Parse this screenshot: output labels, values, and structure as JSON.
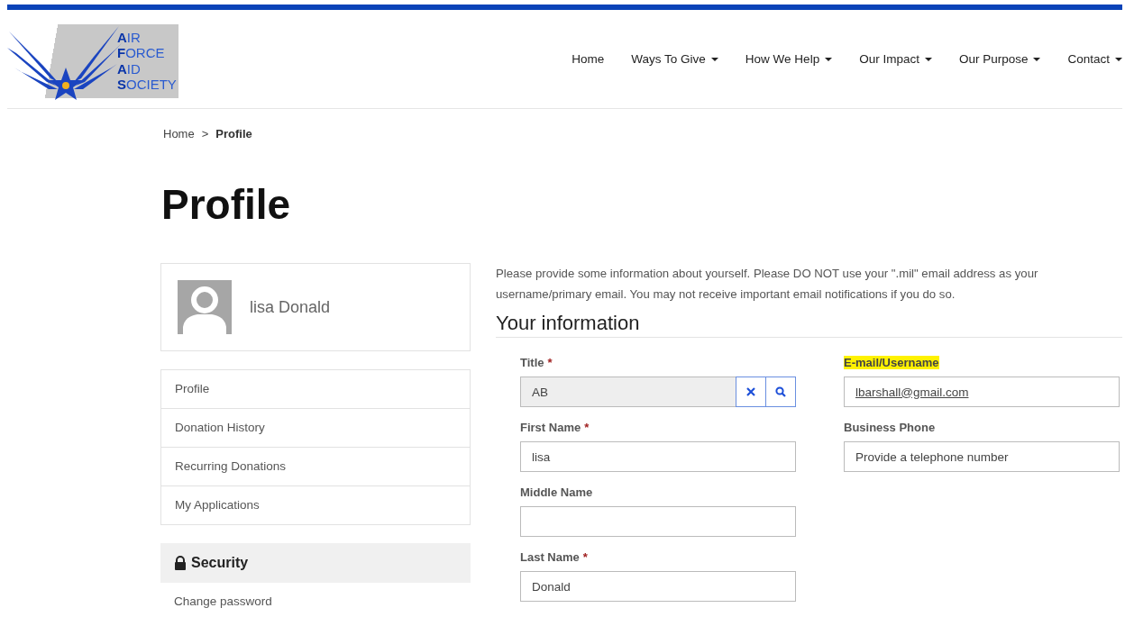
{
  "header": {
    "logo_lines": [
      "**A**IR",
      "**F**ORCE",
      "**A**ID",
      "**S**OCIETY"
    ],
    "nav": [
      {
        "label": "Home",
        "dropdown": false
      },
      {
        "label": "Ways To Give",
        "dropdown": true
      },
      {
        "label": "How We Help",
        "dropdown": true
      },
      {
        "label": "Our Impact",
        "dropdown": true
      },
      {
        "label": "Our Purpose",
        "dropdown": true
      },
      {
        "label": "Contact",
        "dropdown": true
      }
    ]
  },
  "breadcrumb": {
    "items": [
      "Home"
    ],
    "separator": ">",
    "current": "Profile"
  },
  "page_title": "Profile",
  "sidebar": {
    "user_name": "lisa Donald",
    "menu": [
      "Profile",
      "Donation History",
      "Recurring Donations",
      "My Applications"
    ],
    "security": {
      "title": "Security",
      "items": [
        "Change password"
      ]
    }
  },
  "main": {
    "intro": "Please provide some information about yourself. Please DO NOT use your \".mil\" email address as your username/primary email. You may not receive important email notifications if you do so.",
    "section_title": "Your information",
    "columns": [
      [
        {
          "kind": "lookup",
          "label": "Title",
          "mark": "*",
          "value": "AB",
          "highlighted": false
        },
        {
          "kind": "text",
          "label": "First Name",
          "mark": "*",
          "value": "lisa",
          "highlighted": false
        },
        {
          "kind": "text",
          "label": "Middle Name",
          "highlighted": false
        },
        {
          "kind": "text",
          "label": "Last Name",
          "mark": "*",
          "value": "Donald",
          "highlighted": false
        }
      ],
      [
        {
          "kind": "email",
          "label": "E-mail/Username",
          "value": "lbarshall@gmail.com",
          "highlighted": true
        },
        {
          "kind": "text",
          "label": "Business Phone",
          "placeholder": "Provide a telephone number",
          "highlighted": false
        }
      ]
    ]
  }
}
